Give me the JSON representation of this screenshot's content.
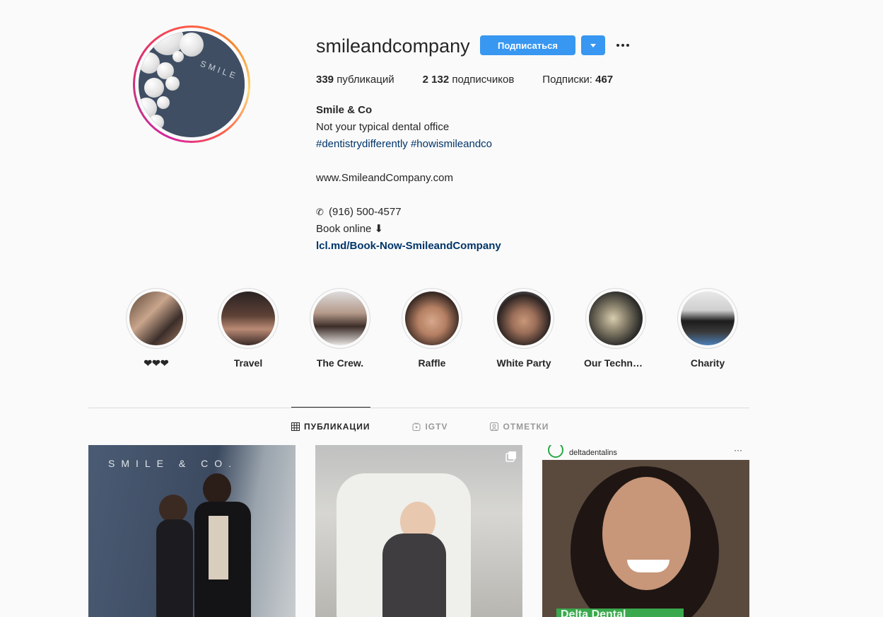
{
  "profile": {
    "username": "smileandcompany",
    "follow_label": "Подписаться",
    "avatar_word": "SMILE",
    "stats": {
      "posts_count": "339",
      "posts_label": " публикаций",
      "followers_count": "2 132",
      "followers_label": " подписчиков",
      "following_label": "Подписки: ",
      "following_count": "467"
    },
    "bio": {
      "name": "Smile & Co",
      "tagline": "Not your typical dental office",
      "hashtags": "#dentistrydifferently #howismileandco",
      "website": "www.SmileandCompany.com",
      "phone": "(916) 500-4577",
      "book_online": "Book online ⬇",
      "book_link": "lcl.md/Book-Now-SmileandCompany"
    }
  },
  "highlights": [
    {
      "label": "❤❤❤"
    },
    {
      "label": "Travel"
    },
    {
      "label": "The Crew."
    },
    {
      "label": "Raffle"
    },
    {
      "label": "White Party"
    },
    {
      "label": "Our Technology"
    },
    {
      "label": "Charity"
    }
  ],
  "tabs": [
    {
      "label": "ПУБЛИКАЦИИ",
      "icon": "grid-icon"
    },
    {
      "label": "IGTV",
      "icon": "igtv-icon"
    },
    {
      "label": "ОТМЕТКИ",
      "icon": "tagged-icon"
    }
  ],
  "posts": {
    "post1_text": "SMILE & CO.",
    "post3_account": "deltadentalins",
    "post3_banner": "Delta Dental"
  },
  "colors": {
    "accent": "#3897f0",
    "link": "#003569",
    "divider": "#dbdbdb"
  }
}
